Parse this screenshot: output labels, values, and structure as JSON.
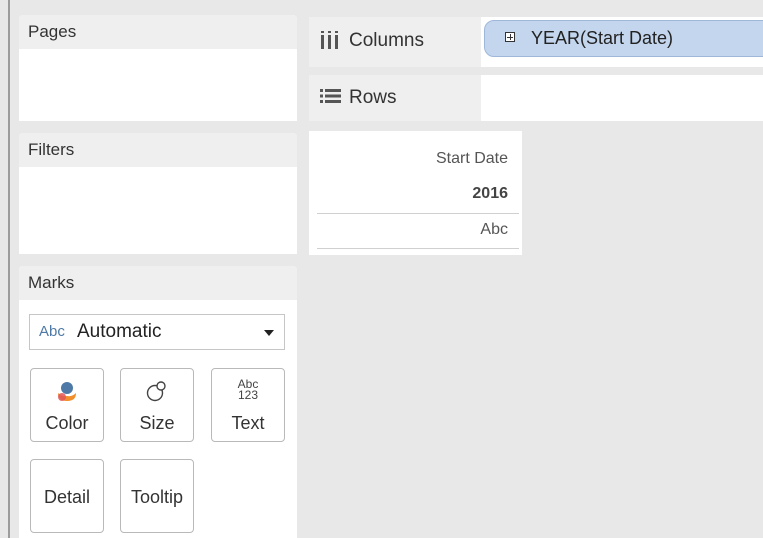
{
  "cards": {
    "pages": {
      "title": "Pages"
    },
    "filters": {
      "title": "Filters"
    },
    "marks": {
      "title": "Marks",
      "mark_type": {
        "icon_text": "Abc",
        "value": "Automatic"
      },
      "buttons": {
        "color": {
          "label": "Color",
          "icon": "color-icon"
        },
        "size": {
          "label": "Size",
          "icon": "size-icon"
        },
        "text": {
          "label": "Text",
          "icon_line1": "Abc",
          "icon_line2": "123"
        },
        "detail": {
          "label": "Detail"
        },
        "tooltip": {
          "label": "Tooltip"
        }
      }
    }
  },
  "shelves": {
    "columns": {
      "label": "Columns",
      "icon": "columns-icon",
      "pill": "YEAR(Start Date)"
    },
    "rows": {
      "label": "Rows",
      "icon": "rows-icon"
    }
  },
  "view": {
    "header": "Start Date",
    "year": "2016",
    "cell": "Abc"
  },
  "colors": {
    "pill_background": "#c3d6ee",
    "mark_type_abc": "#4e79a7",
    "color_icon_blue": "#4e79a7",
    "color_icon_orange": "#f28e2b"
  }
}
